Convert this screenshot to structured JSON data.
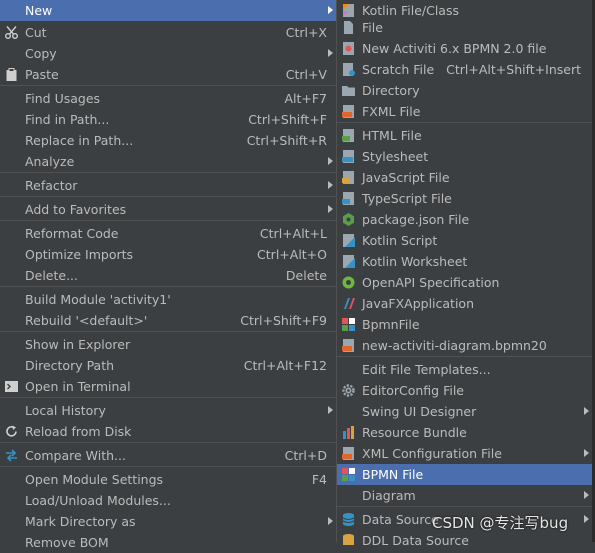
{
  "left_menu": {
    "items": [
      {
        "label": "New",
        "shortcut": "",
        "arrow": true,
        "selected": true,
        "icon": ""
      },
      {
        "label": "Cut",
        "shortcut": "Ctrl+X",
        "icon": "scissors-icon"
      },
      {
        "label": "Copy",
        "shortcut": "",
        "arrow": true,
        "icon": ""
      },
      {
        "label": "Paste",
        "shortcut": "Ctrl+V",
        "icon": "clipboard-icon"
      },
      {
        "label": "Find Usages",
        "shortcut": "Alt+F7",
        "icon": ""
      },
      {
        "label": "Find in Path...",
        "shortcut": "Ctrl+Shift+F",
        "icon": ""
      },
      {
        "label": "Replace in Path...",
        "shortcut": "Ctrl+Shift+R",
        "icon": ""
      },
      {
        "label": "Analyze",
        "shortcut": "",
        "arrow": true,
        "icon": ""
      },
      {
        "label": "Refactor",
        "shortcut": "",
        "arrow": true,
        "icon": ""
      },
      {
        "label": "Add to Favorites",
        "shortcut": "",
        "arrow": true,
        "icon": ""
      },
      {
        "label": "Reformat Code",
        "shortcut": "Ctrl+Alt+L",
        "icon": ""
      },
      {
        "label": "Optimize Imports",
        "shortcut": "Ctrl+Alt+O",
        "icon": ""
      },
      {
        "label": "Delete...",
        "shortcut": "Delete",
        "icon": ""
      },
      {
        "label": "Build Module 'activity1'",
        "shortcut": "",
        "icon": ""
      },
      {
        "label": "Rebuild '<default>'",
        "shortcut": "Ctrl+Shift+F9",
        "icon": ""
      },
      {
        "label": "Show in Explorer",
        "shortcut": "",
        "icon": ""
      },
      {
        "label": "Directory Path",
        "shortcut": "Ctrl+Alt+F12",
        "icon": ""
      },
      {
        "label": "Open in Terminal",
        "shortcut": "",
        "icon": "terminal-icon"
      },
      {
        "label": "Local History",
        "shortcut": "",
        "arrow": true,
        "icon": ""
      },
      {
        "label": "Reload from Disk",
        "shortcut": "",
        "icon": "reload-icon"
      },
      {
        "label": "Compare With...",
        "shortcut": "Ctrl+D",
        "icon": "compare-icon"
      },
      {
        "label": "Open Module Settings",
        "shortcut": "F4",
        "icon": ""
      },
      {
        "label": "Load/Unload Modules...",
        "shortcut": "",
        "icon": ""
      },
      {
        "label": "Mark Directory as",
        "shortcut": "",
        "arrow": true,
        "icon": ""
      },
      {
        "label": "Remove BOM",
        "shortcut": "",
        "icon": ""
      }
    ]
  },
  "right_menu": {
    "items": [
      {
        "label": "Kotlin File/Class",
        "shortcut": "",
        "icon": "kotlin-file-icon"
      },
      {
        "label": "File",
        "shortcut": "",
        "icon": "file-icon"
      },
      {
        "label": "New Activiti 6.x BPMN 2.0 file",
        "shortcut": "",
        "icon": "activiti-icon"
      },
      {
        "label": "Scratch File",
        "shortcut": "Ctrl+Alt+Shift+Insert",
        "icon": "scratch-file-icon"
      },
      {
        "label": "Directory",
        "shortcut": "",
        "icon": "folder-icon"
      },
      {
        "label": "FXML File",
        "shortcut": "",
        "icon": "fxml-icon"
      },
      {
        "label": "HTML File",
        "shortcut": "",
        "icon": "html-icon"
      },
      {
        "label": "Stylesheet",
        "shortcut": "",
        "icon": "css-icon"
      },
      {
        "label": "JavaScript File",
        "shortcut": "",
        "icon": "javascript-icon"
      },
      {
        "label": "TypeScript File",
        "shortcut": "",
        "icon": "typescript-icon"
      },
      {
        "label": "package.json File",
        "shortcut": "",
        "icon": "nodejs-icon"
      },
      {
        "label": "Kotlin Script",
        "shortcut": "",
        "icon": "kotlin-script-icon"
      },
      {
        "label": "Kotlin Worksheet",
        "shortcut": "",
        "icon": "kotlin-worksheet-icon"
      },
      {
        "label": "OpenAPI Specification",
        "shortcut": "",
        "icon": "openapi-icon"
      },
      {
        "label": "JavaFXApplication",
        "shortcut": "",
        "icon": "javafx-icon"
      },
      {
        "label": "BpmnFile",
        "shortcut": "",
        "icon": "bpmn-icon"
      },
      {
        "label": "new-activiti-diagram.bpmn20",
        "shortcut": "",
        "icon": "xml-diagram-icon"
      },
      {
        "label": "Edit File Templates...",
        "shortcut": "",
        "icon": ""
      },
      {
        "label": "EditorConfig File",
        "shortcut": "",
        "icon": "gear-icon"
      },
      {
        "label": "Swing UI Designer",
        "shortcut": "",
        "arrow": true,
        "icon": ""
      },
      {
        "label": "Resource Bundle",
        "shortcut": "",
        "icon": "resource-bundle-icon"
      },
      {
        "label": "XML Configuration File",
        "shortcut": "",
        "arrow": true,
        "icon": "xml-config-icon"
      },
      {
        "label": "BPMN File",
        "shortcut": "",
        "selected": true,
        "icon": "bpmn-icon"
      },
      {
        "label": "Diagram",
        "shortcut": "",
        "arrow": true,
        "icon": ""
      },
      {
        "label": "Data Source",
        "shortcut": "",
        "arrow": true,
        "icon": "database-icon"
      },
      {
        "label": "DDL Data Source",
        "shortcut": "",
        "icon": "ddl-icon"
      }
    ]
  },
  "watermark": {
    "text": "CSDN @专注写bug"
  },
  "colors": {
    "background": "#3c3f41",
    "selection": "#4b6eaf",
    "text": "#bbbbbb",
    "separator": "#515151"
  }
}
